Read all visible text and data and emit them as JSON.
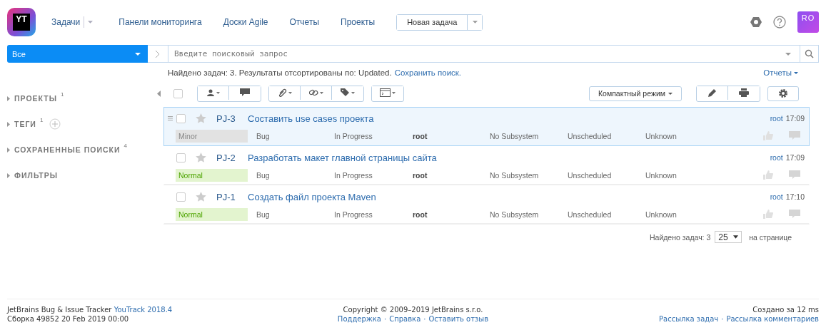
{
  "header": {
    "logo": "YT",
    "nav": [
      {
        "label": "Задачи",
        "kind": "dropdown"
      },
      {
        "label": "Панели мониторинга",
        "kind": "link"
      },
      {
        "label": "Доски Agile",
        "kind": "link"
      },
      {
        "label": "Отчеты",
        "kind": "link"
      },
      {
        "label": "Проекты",
        "kind": "link"
      }
    ],
    "new_issue": "Новая задача",
    "avatar": "RO"
  },
  "search": {
    "context": "Все",
    "placeholder": "Введите поисковый запрос"
  },
  "summary": {
    "text": "Найдено задач: 3. Результаты отсортированы по: Updated.",
    "save_link": "Сохранить поиск.",
    "reports": "Отчеты"
  },
  "sidebar": [
    {
      "label": "ПРОЕКТЫ",
      "count": "1",
      "can_add": false
    },
    {
      "label": "ТЕГИ",
      "count": "1",
      "can_add": true
    },
    {
      "label": "СОХРАНЕННЫЕ ПОИСКИ",
      "count": "4",
      "can_add": false
    },
    {
      "label": "ФИЛЬТРЫ",
      "can_add": false
    }
  ],
  "toolbar": {
    "select_all_checked": false,
    "view_mode": "Компактный режим"
  },
  "issues": [
    {
      "id": "PJ-3",
      "summary": "Составить use cases проекта",
      "selected": true,
      "checked": false,
      "priority": "Minor",
      "color": "#e2e2e2",
      "type": "Bug",
      "state": "In Progress",
      "assignee": "root",
      "subsystem": "No Subsystem",
      "fix_version": "Unscheduled",
      "affected": "Unknown",
      "reporter": "root",
      "time": "17:09"
    },
    {
      "id": "PJ-2",
      "summary": "Разработать макет главной страницы сайта",
      "selected": false,
      "checked": false,
      "priority": "Normal",
      "color": "#e3f4cf",
      "type": "Bug",
      "state": "In Progress",
      "assignee": "root",
      "subsystem": "No Subsystem",
      "fix_version": "Unscheduled",
      "affected": "Unknown",
      "reporter": "root",
      "time": "17:09"
    },
    {
      "id": "PJ-1",
      "summary": "Создать файл проекта Maven",
      "selected": false,
      "checked": false,
      "priority": "Normal",
      "color": "#e3f4cf",
      "type": "Bug",
      "state": "In Progress",
      "assignee": "root",
      "subsystem": "No Subsystem",
      "fix_version": "Unscheduled",
      "affected": "Unknown",
      "reporter": "root",
      "time": "17:10"
    }
  ],
  "pager": {
    "found": "Найдено задач: 3",
    "page_size": "25",
    "suffix": "на странице"
  },
  "footer": {
    "product": "JetBrains Bug & Issue Tracker",
    "version_link": "YouTrack 2018.4",
    "build": "Сборка 49852 20 Feb 2019 00:00",
    "copyright": "Copyright © 2009–2019 JetBrains s.r.o.",
    "separator": "·",
    "center_links": [
      "Поддержка",
      "Справка",
      "Оставить отзыв"
    ],
    "timing": "Создано за 12 ms",
    "right_links": [
      "Рассылка задач",
      "Рассылка комментариев"
    ]
  }
}
